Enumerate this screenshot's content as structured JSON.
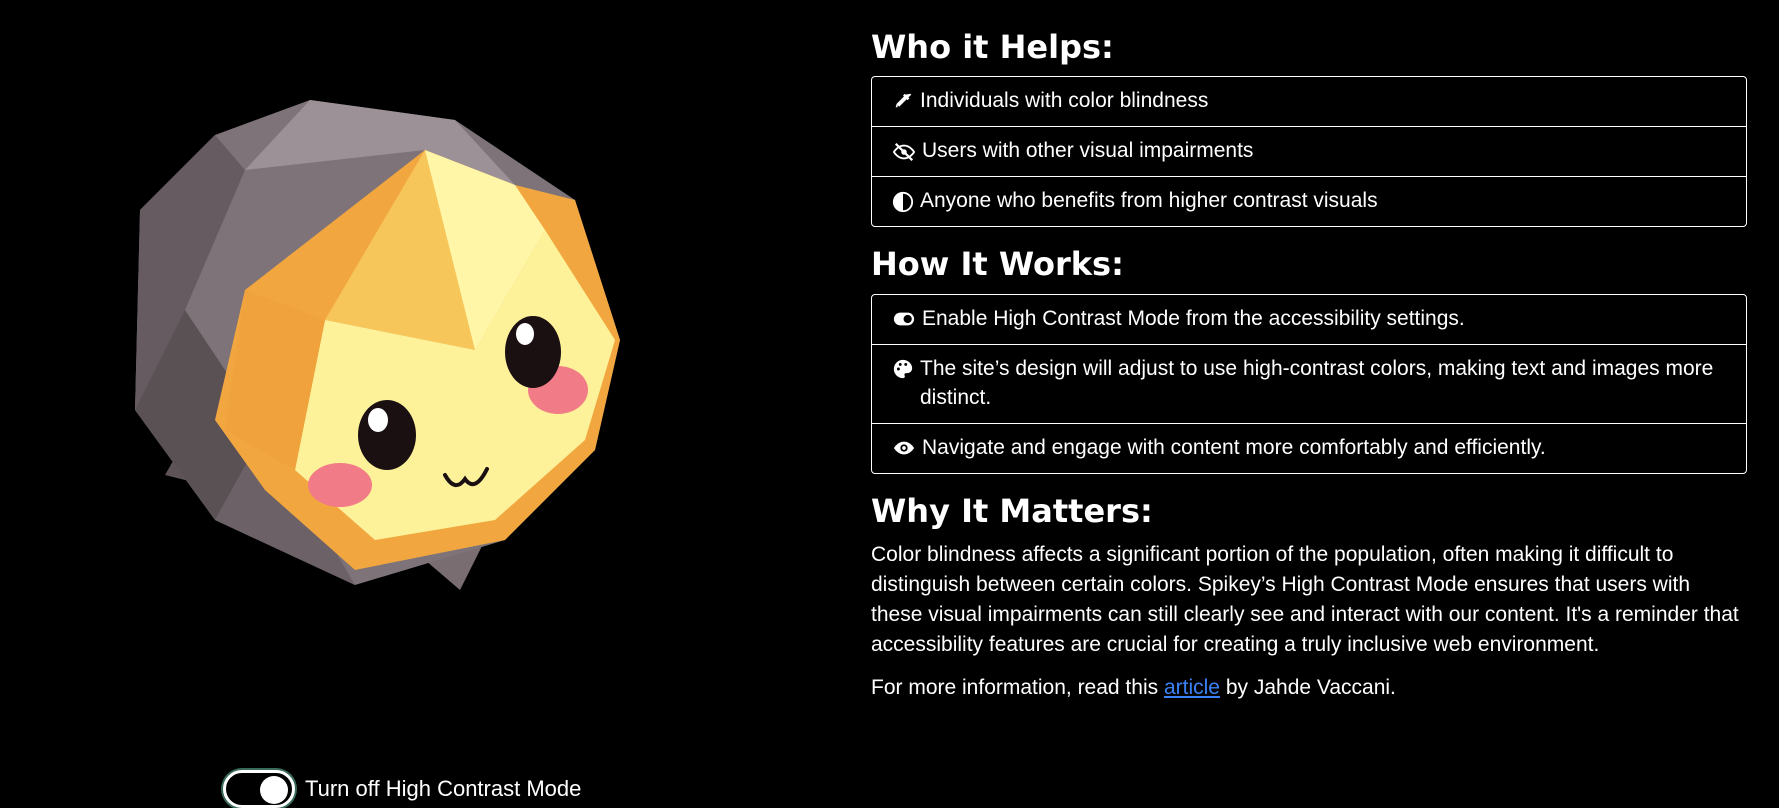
{
  "toggle": {
    "label": "Turn off High Contrast Mode",
    "state": "on"
  },
  "who": {
    "heading": "Who it Helps:",
    "items": [
      {
        "icon": "eyedropper-icon",
        "text": "Individuals with color blindness"
      },
      {
        "icon": "eye-slash-icon",
        "text": "Users with other visual impairments"
      },
      {
        "icon": "half-circle-icon",
        "text": "Anyone who benefits from higher contrast visuals"
      }
    ]
  },
  "how": {
    "heading": "How It Works:",
    "items": [
      {
        "icon": "toggle-on-icon",
        "text": "Enable High Contrast Mode from the accessibility settings."
      },
      {
        "icon": "palette-icon",
        "text": "The site’s design will adjust to use high-contrast colors, making text and images more distinct."
      },
      {
        "icon": "eye-icon",
        "text": "Navigate and engage with content more comfortably and efficiently."
      }
    ]
  },
  "why": {
    "heading": "Why It Matters:",
    "paragraph": "Color blindness affects a significant portion of the population, often making it difficult to distinguish between certain colors. Spikey’s High Contrast Mode ensures that users with these visual impairments can still clearly see and interact with our content. It's a reminder that accessibility features are crucial for creating a truly inclusive web environment.",
    "more_prefix": "For more information, read this ",
    "more_link": "article",
    "more_suffix": " by Jahde Vaccani."
  },
  "colors": {
    "background": "#000000",
    "text": "#ffffff",
    "link": "#3b82f6"
  }
}
